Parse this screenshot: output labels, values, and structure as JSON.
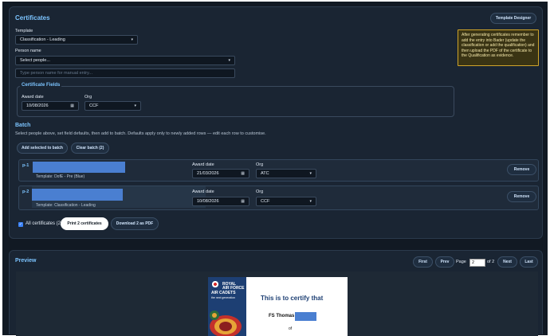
{
  "certificates": {
    "title": "Certificates",
    "template_designer_label": "Template Designer",
    "template": {
      "label": "Template",
      "value": "Classification - Leading"
    },
    "person_name": {
      "label": "Person name",
      "select_value": "Select people...",
      "manual_placeholder": "Type person name for manual entry..."
    },
    "note": "After generating certificates remember to add the entry into Bader (update the classification or add the qualification) and then upload the PDF of the certificate to the Qualification as evidence.",
    "fields": {
      "legend": "Certificate Fields",
      "award_date_label": "Award date",
      "award_date_value": "10/08/2026",
      "org_label": "Org",
      "org_value": "CCF"
    }
  },
  "batch": {
    "title": "Batch",
    "help": "Select people above, set field defaults, then add to batch. Defaults apply only to newly added rows — edit each row to customise.",
    "add_label": "Add selected to batch",
    "clear_label": "Clear batch (2)",
    "rows": [
      {
        "id": "p-1",
        "template": "Template: DofE - Pre (Blue)",
        "award_label": "Award date",
        "award_value": "21/03/2026",
        "org_label": "Org",
        "org_value": "ATC",
        "remove_label": "Remove"
      },
      {
        "id": "p-2",
        "template": "Template: Classification - Leading",
        "award_label": "Award date",
        "award_value": "10/08/2026",
        "org_label": "Org",
        "org_value": "CCF",
        "remove_label": "Remove"
      }
    ],
    "all_certificates_label": "All certificates (2)",
    "print_label": "Print 2 certificates",
    "download_label": "Download 2 as PDF"
  },
  "preview": {
    "title": "Preview",
    "first": "First",
    "prev": "Prev",
    "page_label": "Page",
    "page_value": "2",
    "of_label": "of 2",
    "next": "Next",
    "last": "Last",
    "cert": {
      "logo_royal": "ROYAL",
      "logo_air_force": "AIR FORCE",
      "logo_air_cadets": "AIR CADETS",
      "logo_tagline": "the next generation",
      "title": "This is to certify that",
      "name": "FS Thomas",
      "of": "of"
    }
  },
  "colors": {
    "accent": "#7cc4ff",
    "background": "#111923",
    "card": "#1a2533",
    "redaction": "#4a7fd1",
    "note_border": "#d0a52a"
  }
}
